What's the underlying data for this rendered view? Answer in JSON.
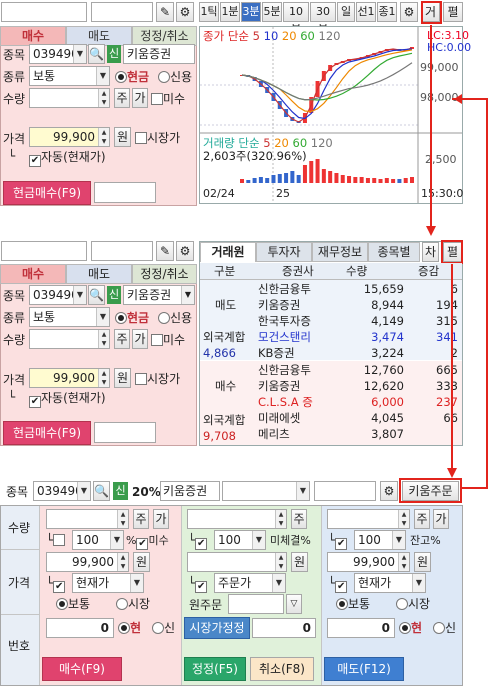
{
  "top_bar": {
    "intervals": [
      "1틱",
      "1분",
      "3분",
      "5분",
      "10분",
      "30분",
      "일",
      "선1",
      "종1"
    ],
    "active_interval": "3분",
    "go_button": "거",
    "pyeon_button": "펼"
  },
  "order1": {
    "tabs": [
      "매수",
      "매도",
      "정정/취소"
    ],
    "labels": {
      "code": "종목",
      "type": "종류",
      "qty": "수량",
      "price": "가격"
    },
    "code": "039490",
    "sin_badge": "신",
    "stock_name": "키움증권",
    "order_kind": "보통",
    "radio_cash": "현금",
    "radio_credit": "신용",
    "qty_btn_ju": "주",
    "qty_btn_ga": "가",
    "unfilled": "미수",
    "price": "99,900",
    "price_unit": "원",
    "market_price": "시장가",
    "auto_label": "자동(현재가)",
    "tree": "└",
    "submit": "현금매수(F9)"
  },
  "chart": {
    "legend_price": "종가 단순",
    "ma_values": [
      "5",
      "10",
      "20",
      "60",
      "120"
    ],
    "lc": "LC:3.10",
    "hc": "HC:0.00",
    "y_ticks": [
      "99,000",
      "98,000"
    ],
    "vol_legend": "거래량 단순",
    "vol_ma": [
      "5",
      "20",
      "60",
      "120"
    ],
    "vol_value": "2,603주(320.96%)",
    "vol_tick": "2,500",
    "x_labels": [
      "02/24",
      "25",
      "15:30:0"
    ]
  },
  "order2": {
    "tabs": [
      "매수",
      "매도",
      "정정/취소"
    ],
    "code": "039490",
    "sin_badge": "신",
    "stock_name": "키움증권",
    "order_kind": "보통",
    "radio_cash": "현금",
    "radio_credit": "신용",
    "qty_btn_ju": "주",
    "qty_btn_ga": "가",
    "unfilled": "미수",
    "price": "99,900",
    "price_unit": "원",
    "market_price": "시장가",
    "auto_label": "자동(현재가)",
    "submit": "현금매수(F9)",
    "labels": {
      "code": "종목",
      "type": "종류",
      "qty": "수량",
      "price": "가격"
    }
  },
  "broker_panel": {
    "tabs": [
      "거래원",
      "투자자",
      "재무정보",
      "종목별"
    ],
    "chart_btn": "차",
    "pyeon_btn": "펼",
    "headers": [
      "구분",
      "증권사",
      "수량",
      "증감"
    ],
    "sell_label": "매도",
    "sell_rows": [
      {
        "firm": "신한금융투",
        "qty": "15,659",
        "chg": "6"
      },
      {
        "firm": "키움증권",
        "qty": "8,944",
        "chg": "194"
      },
      {
        "firm": "한국투자증",
        "qty": "4,149",
        "chg": "315"
      },
      {
        "firm": "모건스탠리",
        "qty": "3,474",
        "chg": "341"
      },
      {
        "firm": "KB증권",
        "qty": "3,224",
        "chg": "2"
      }
    ],
    "foreign_sell_label": "외국계합",
    "foreign_sell_val": "4,866",
    "buy_label": "매수",
    "buy_rows": [
      {
        "firm": "신한금융투",
        "qty": "12,760",
        "chg": "665"
      },
      {
        "firm": "키움증권",
        "qty": "12,620",
        "chg": "333"
      },
      {
        "firm": "C.L.S.A 증",
        "qty": "6,000",
        "chg": "237"
      },
      {
        "firm": "미래에셋",
        "qty": "4,045",
        "chg": "66"
      },
      {
        "firm": "메리츠",
        "qty": "3,807",
        "chg": ""
      }
    ],
    "foreign_buy_label": "외국계합",
    "foreign_buy_val": "9,708"
  },
  "bottom": {
    "code_label": "종목",
    "code": "039490",
    "sin_badge": "신",
    "margin": "20%",
    "stock_name": "키움증권",
    "order_button": "키움주문",
    "row_labels": {
      "qty": "수량",
      "price": "가격",
      "number": "번호"
    },
    "buy": {
      "ju": "주",
      "ga": "가",
      "pct": "100",
      "unfilled": "미수",
      "price": "99,900",
      "unit": "원",
      "price_type": "현재가",
      "radio1": "보통",
      "radio2": "시장",
      "number": "0",
      "r_hyeon": "현",
      "r_sin": "신",
      "submit": "매수(F9)"
    },
    "modify": {
      "ju": "주",
      "pct": "100",
      "unfilled": "미체결",
      "price_unit": "원",
      "price_type": "주문가",
      "orig_label": "원주문",
      "market_modify": "시장가정정",
      "number": "0",
      "submit_modify": "정정(F5)",
      "submit_cancel": "취소(F8)"
    },
    "sell": {
      "ju": "주",
      "ga": "가",
      "pct": "100",
      "balance": "잔고",
      "price": "99,900",
      "unit": "원",
      "price_type": "현재가",
      "radio1": "보통",
      "radio2": "시장",
      "number": "0",
      "r_hyeon": "현",
      "r_sin": "신",
      "submit": "매도(F12)"
    }
  },
  "colors": {
    "buy_bg": "#fbe0e0",
    "modify_bg": "#e0f1da",
    "sell_bg": "#dde8f6",
    "highlight": "#e2241c",
    "grid_label": "#e8eef6"
  },
  "chart_data": {
    "type": "line",
    "series": [
      {
        "name": "종가",
        "values": [
          99250,
          99200,
          99100,
          98950,
          98800,
          98600,
          98400,
          98200,
          98100,
          98050,
          98300,
          98700,
          99100,
          99350,
          99500,
          99550,
          99600,
          99650,
          99650,
          99700,
          99750,
          99800,
          99850,
          99900,
          99900,
          99850,
          99900,
          99950
        ]
      }
    ]
  }
}
